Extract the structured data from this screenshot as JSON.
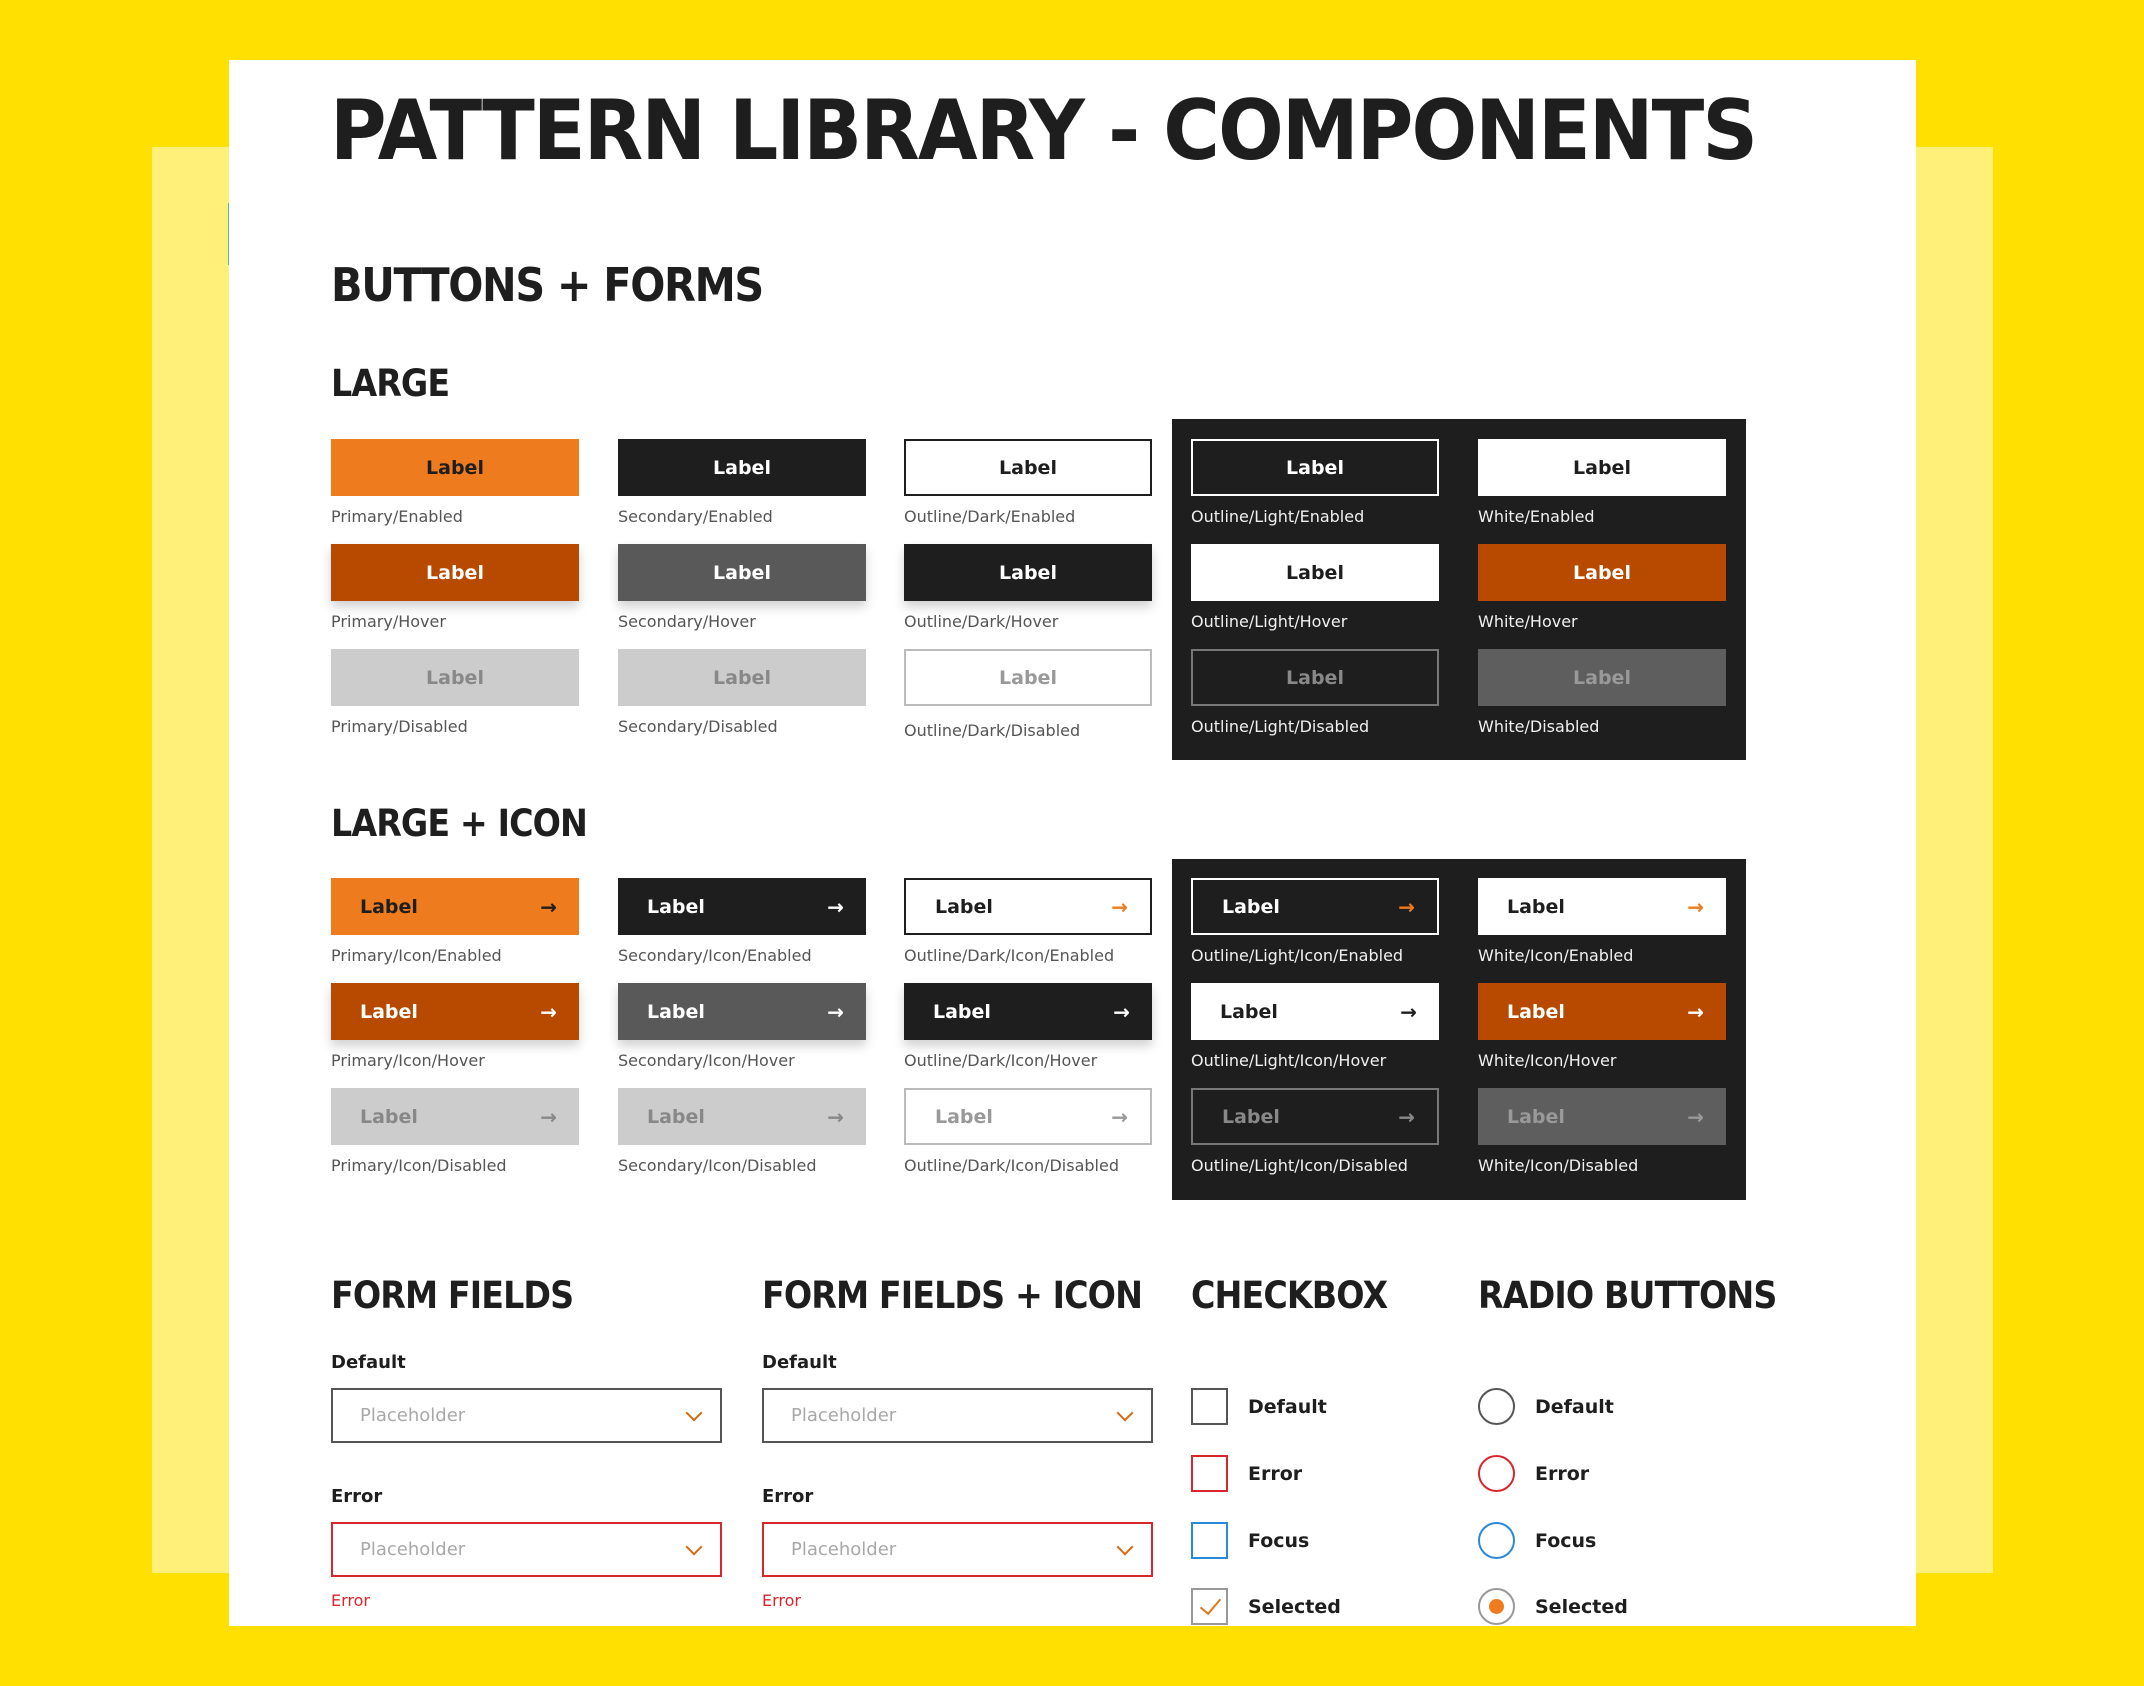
{
  "title": "PATTERN LIBRARY - COMPONENTS",
  "section_heading": "BUTTONS + FORMS",
  "colors": {
    "background_yellow": "#FFE000",
    "panel_light_yellow": "#FFF07A",
    "primary_orange": "#EE7B1E",
    "primary_hover": "#B84A00",
    "dark": "#1E1E1E",
    "secondary_hover": "#595959",
    "disabled": "#CCCCCC",
    "error_red": "#D8262C",
    "focus_blue": "#2A8AD8"
  },
  "large": {
    "heading": "LARGE",
    "buttons": [
      {
        "label": "Label",
        "caption": "Primary/Enabled"
      },
      {
        "label": "Label",
        "caption": "Secondary/Enabled"
      },
      {
        "label": "Label",
        "caption": "Outline/Dark/Enabled"
      },
      {
        "label": "Label",
        "caption": "Outline/Light/Enabled"
      },
      {
        "label": "Label",
        "caption": "White/Enabled"
      },
      {
        "label": "Label",
        "caption": "Primary/Hover"
      },
      {
        "label": "Label",
        "caption": "Secondary/Hover"
      },
      {
        "label": "Label",
        "caption": "Outline/Dark/Hover"
      },
      {
        "label": "Label",
        "caption": "Outline/Light/Hover"
      },
      {
        "label": "Label",
        "caption": "White/Hover"
      },
      {
        "label": "Label",
        "caption": "Primary/Disabled"
      },
      {
        "label": "Label",
        "caption": "Secondary/Disabled"
      },
      {
        "label": "Label",
        "caption": "Outline/Dark/Disabled"
      },
      {
        "label": "Label",
        "caption": "Outline/Light/Disabled"
      },
      {
        "label": "Label",
        "caption": "White/Disabled"
      }
    ]
  },
  "large_icon": {
    "heading": "LARGE + ICON",
    "icon": "arrow-right-icon",
    "arrow_glyph": "→",
    "buttons": [
      {
        "label": "Label",
        "caption": "Primary/Icon/Enabled"
      },
      {
        "label": "Label",
        "caption": "Secondary/Icon/Enabled"
      },
      {
        "label": "Label",
        "caption": "Outline/Dark/Icon/Enabled"
      },
      {
        "label": "Label",
        "caption": "Outline/Light/Icon/Enabled"
      },
      {
        "label": "Label",
        "caption": "White/Icon/Enabled"
      },
      {
        "label": "Label",
        "caption": "Primary/Icon/Hover"
      },
      {
        "label": "Label",
        "caption": "Secondary/Icon/Hover"
      },
      {
        "label": "Label",
        "caption": "Outline/Dark/Icon/Hover"
      },
      {
        "label": "Label",
        "caption": "Outline/Light/Icon/Hover"
      },
      {
        "label": "Label",
        "caption": "White/Icon/Hover"
      },
      {
        "label": "Label",
        "caption": "Primary/Icon/Disabled"
      },
      {
        "label": "Label",
        "caption": "Secondary/Icon/Disabled"
      },
      {
        "label": "Label",
        "caption": "Outline/Dark/Icon/Disabled"
      },
      {
        "label": "Label",
        "caption": "Outline/Light/Icon/Disabled"
      },
      {
        "label": "Label",
        "caption": "White/Icon/Disabled"
      }
    ]
  },
  "form_fields": {
    "heading": "FORM FIELDS",
    "default_label": "Default",
    "default_placeholder": "Placeholder",
    "error_label": "Error",
    "error_placeholder": "Placeholder",
    "error_message": "Error"
  },
  "form_fields_icon": {
    "heading": "FORM FIELDS + ICON",
    "default_label": "Default",
    "default_placeholder": "Placeholder",
    "error_label": "Error",
    "error_placeholder": "Placeholder",
    "error_message": "Error"
  },
  "checkbox": {
    "heading": "CHECKBOX",
    "options": [
      {
        "label": "Default",
        "state": "default",
        "checked": false
      },
      {
        "label": "Error",
        "state": "error",
        "checked": false
      },
      {
        "label": "Focus",
        "state": "focus",
        "checked": false
      },
      {
        "label": "Selected",
        "state": "selected",
        "checked": true
      }
    ]
  },
  "radio": {
    "heading": "RADIO BUTTONS",
    "options": [
      {
        "label": "Default",
        "state": "default",
        "checked": false
      },
      {
        "label": "Error",
        "state": "error",
        "checked": false
      },
      {
        "label": "Focus",
        "state": "focus",
        "checked": false
      },
      {
        "label": "Selected",
        "state": "selected",
        "checked": true
      }
    ]
  }
}
